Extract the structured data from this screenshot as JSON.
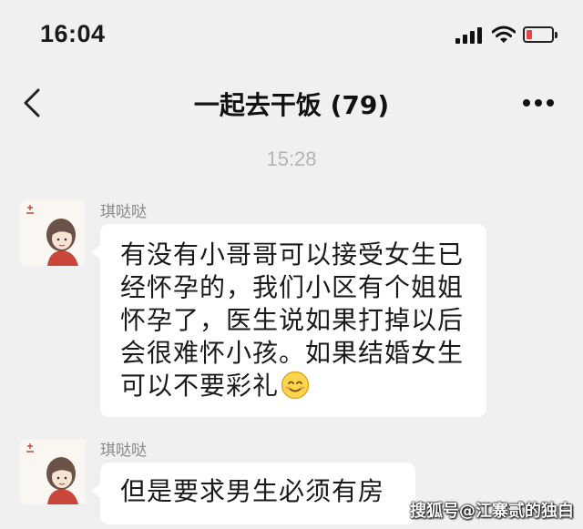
{
  "status_bar": {
    "time": "16:04",
    "icons": [
      "cellular-signal-icon",
      "wifi-icon",
      "battery-low-icon"
    ],
    "battery_color": "#e6454a"
  },
  "nav_bar": {
    "back_icon": "chevron-left-icon",
    "title": "一起去干饭 (79)",
    "more_icon": "ellipsis-icon"
  },
  "chat": {
    "timestamp": "15:28",
    "messages": [
      {
        "sender": "琪哒哒",
        "avatar_icon": "cartoon-girl-avatar",
        "lines": [
          "有没有小哥哥可以接受女生已",
          "经怀孕的，我们小区有个姐姐",
          "怀孕了，医生说如果打掉以后",
          "会很难怀小孩。如果结婚女生",
          "可以不要彩礼"
        ],
        "emoji": "smiling-face-icon"
      },
      {
        "sender": "琪哒哒",
        "avatar_icon": "cartoon-girl-avatar",
        "lines": [
          "但是要求男生必须有房"
        ]
      }
    ]
  },
  "watermark": "搜狐号@江寨贰的独白"
}
